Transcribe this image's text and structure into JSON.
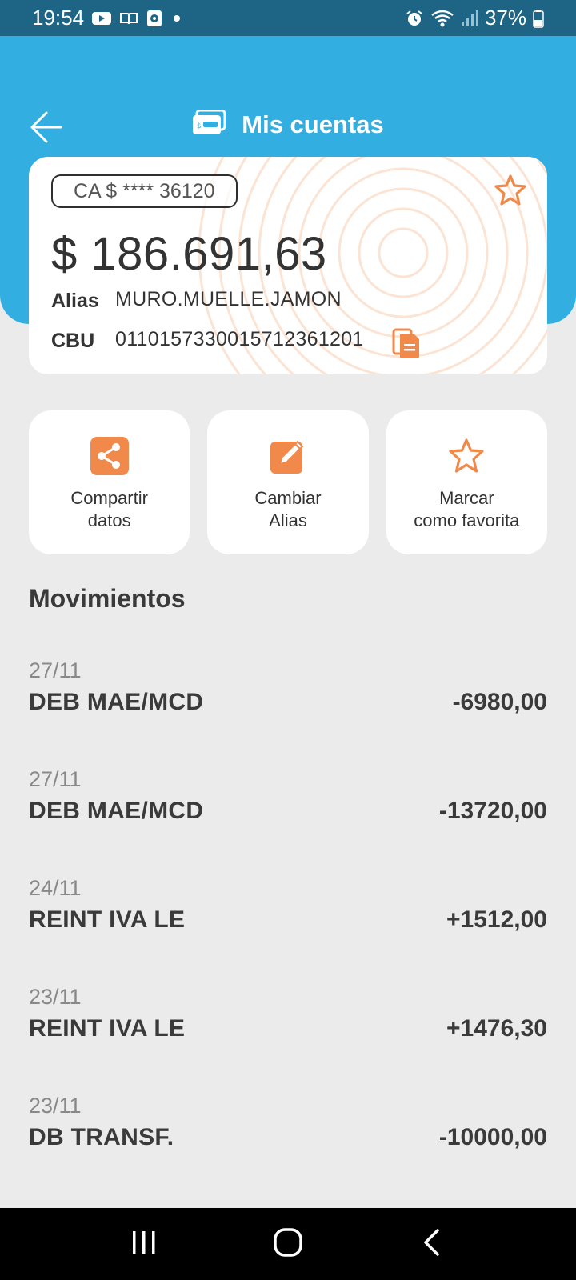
{
  "status_bar": {
    "time": "19:54",
    "battery": "37%",
    "left_icons": [
      "youtube-icon",
      "book-icon",
      "app-icon",
      "dot-icon"
    ],
    "right_icons": [
      "alarm-icon",
      "wifi-icon",
      "signal-icon",
      "battery-icon"
    ]
  },
  "header": {
    "title": "Mis cuentas",
    "back_icon": "arrow-left-icon",
    "title_icon": "card-icon"
  },
  "account": {
    "chip_label": "CA $ **** 36120",
    "balance": "$ 186.691,63",
    "alias_label": "Alias",
    "alias_value": "MURO.MUELLE.JAMON",
    "cbu_label": "CBU",
    "cbu_value": "0110157330015712361201",
    "favorite_icon": "star-outline-icon",
    "copy_icon": "copy-icon"
  },
  "actions": [
    {
      "label": "Compartir\ndatos",
      "icon": "share-icon"
    },
    {
      "label": "Cambiar\nAlias",
      "icon": "edit-icon"
    },
    {
      "label": "Marcar\ncomo favorita",
      "icon": "star-outline-icon"
    }
  ],
  "movements_title": "Movimientos",
  "movements": [
    {
      "date": "27/11",
      "description": "DEB MAE/MCD",
      "amount": "-6980,00"
    },
    {
      "date": "27/11",
      "description": "DEB MAE/MCD",
      "amount": "-13720,00"
    },
    {
      "date": "24/11",
      "description": "REINT IVA LE",
      "amount": "+1512,00"
    },
    {
      "date": "23/11",
      "description": "REINT IVA LE",
      "amount": "+1476,30"
    },
    {
      "date": "23/11",
      "description": "DB TRANSF.",
      "amount": "-10000,00"
    }
  ],
  "nav_bar": {
    "buttons": [
      "recent-apps-icon",
      "home-icon",
      "back-icon"
    ]
  },
  "colors": {
    "status_bar": "#1e6585",
    "header": "#33aee0",
    "accent_orange": "#f0894a",
    "background": "#ebebeb"
  }
}
